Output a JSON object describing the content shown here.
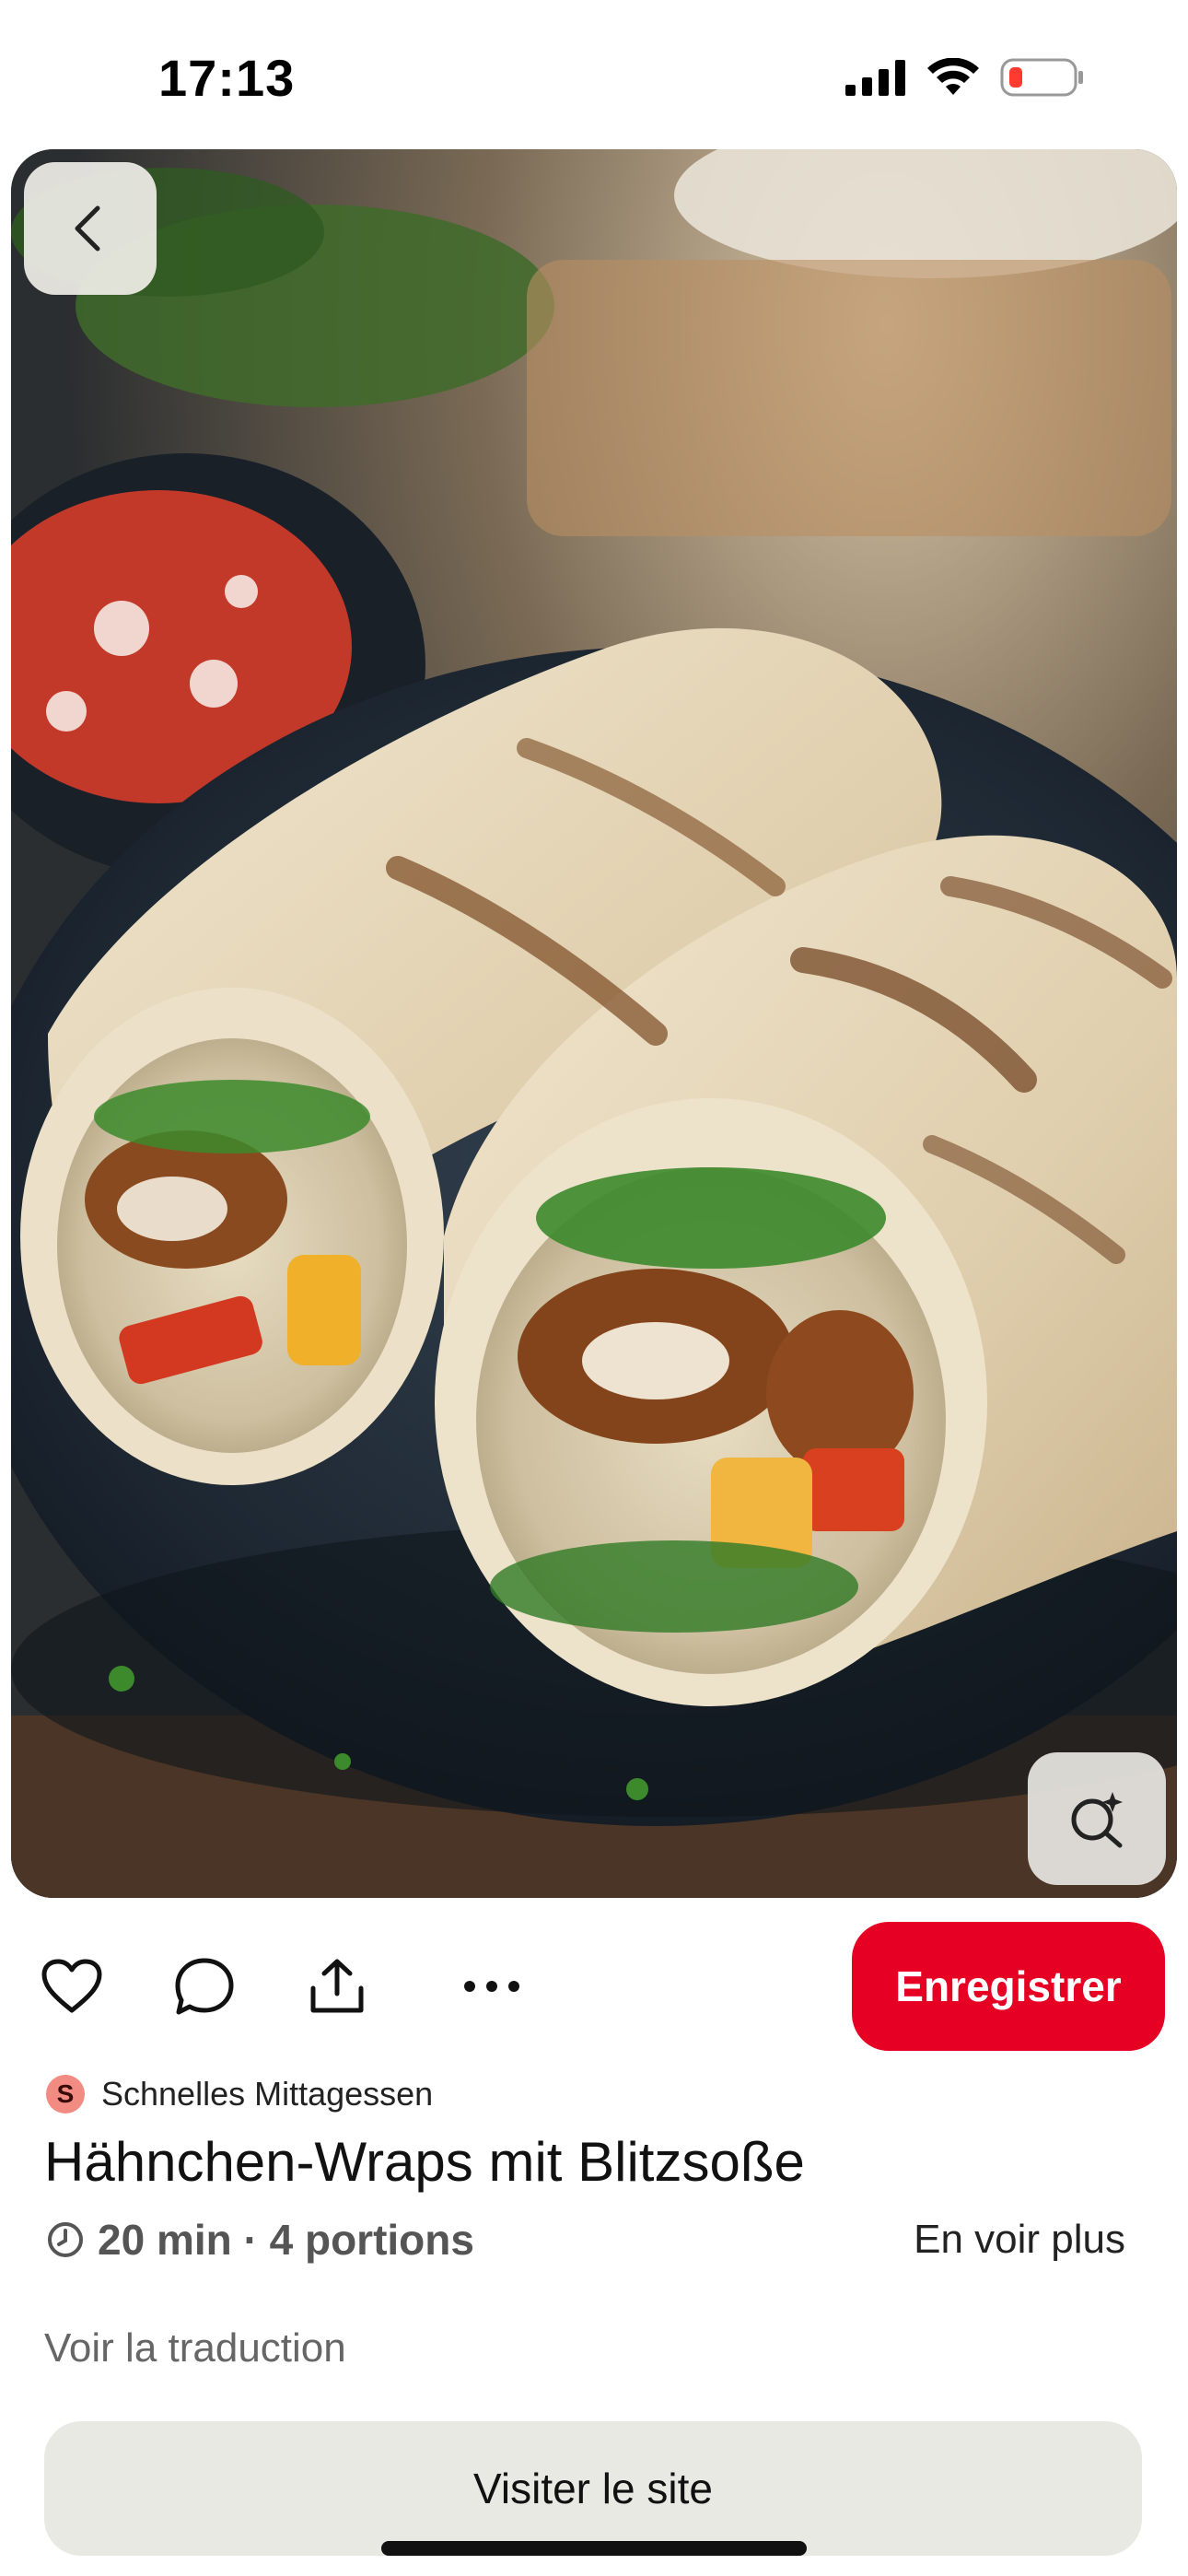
{
  "status_bar": {
    "time": "17:13",
    "icons": [
      "cellular-signal-icon",
      "wifi-icon",
      "battery-low-icon"
    ],
    "battery_color": "#ff3b30"
  },
  "hero": {
    "back_icon": "chevron-left-icon",
    "lens_icon": "visual-search-icon"
  },
  "actions": {
    "icons": [
      "heart-icon",
      "comment-icon",
      "share-icon",
      "more-icon"
    ],
    "save_label": "Enregistrer",
    "save_color": "#e60023"
  },
  "pin": {
    "board_initial": "S",
    "board_name": "Schnelles Mittagessen",
    "title": "Hähnchen-Wraps mit Blitzsoße",
    "meta": "20 min · 4 portions",
    "see_more": "En voir plus",
    "translation": "Voir la traduction"
  },
  "visit": {
    "label": "Visiter le site"
  }
}
